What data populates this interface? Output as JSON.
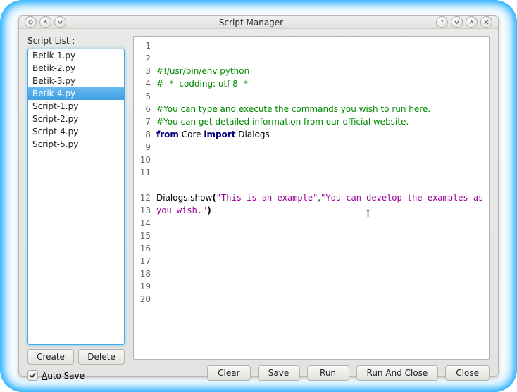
{
  "window": {
    "title": "Script Manager"
  },
  "sidebar": {
    "label": "Script List :",
    "items": [
      "Betik-1.py",
      "Betik-2.py",
      "Betik-3.py",
      "Betik-4.py",
      "Script-1.py",
      "Script-2.py",
      "Script-4.py",
      "Script-5.py"
    ],
    "selected_index": 3,
    "create_label": "Create",
    "delete_label": "Delete",
    "autosave_label": "Auto Save",
    "autosave_underline_char": "A",
    "autosave_checked": true
  },
  "editor": {
    "visible_line_start": 1,
    "visible_line_end": 20,
    "lines": {
      "1": {
        "type": "comment",
        "text": "#!/usr/bin/env python"
      },
      "2": {
        "type": "comment",
        "text": "# -*- codding: utf-8 -*-"
      },
      "3": {
        "type": "blank"
      },
      "4": {
        "type": "comment",
        "text": "#You can type and execute the commands you wish to run here."
      },
      "5": {
        "type": "comment",
        "text": "#You can get detailed information from our official website."
      },
      "6": {
        "type": "import",
        "kw1": "from",
        "mod": "Core",
        "kw2": "import",
        "name": "Dialogs"
      },
      "7": {
        "type": "blank"
      },
      "8": {
        "type": "blank"
      },
      "9": {
        "type": "blank"
      },
      "10": {
        "type": "blank"
      },
      "11": {
        "type": "call",
        "obj": "Dialogs.show",
        "str1": "\"This is an example\"",
        "str2": "\"You can develop the examples as you wish.\""
      }
    }
  },
  "buttons": {
    "clear": "Clear",
    "save": "Save",
    "run": "Run",
    "run_and_close": "Run And Close",
    "close": "Close"
  }
}
